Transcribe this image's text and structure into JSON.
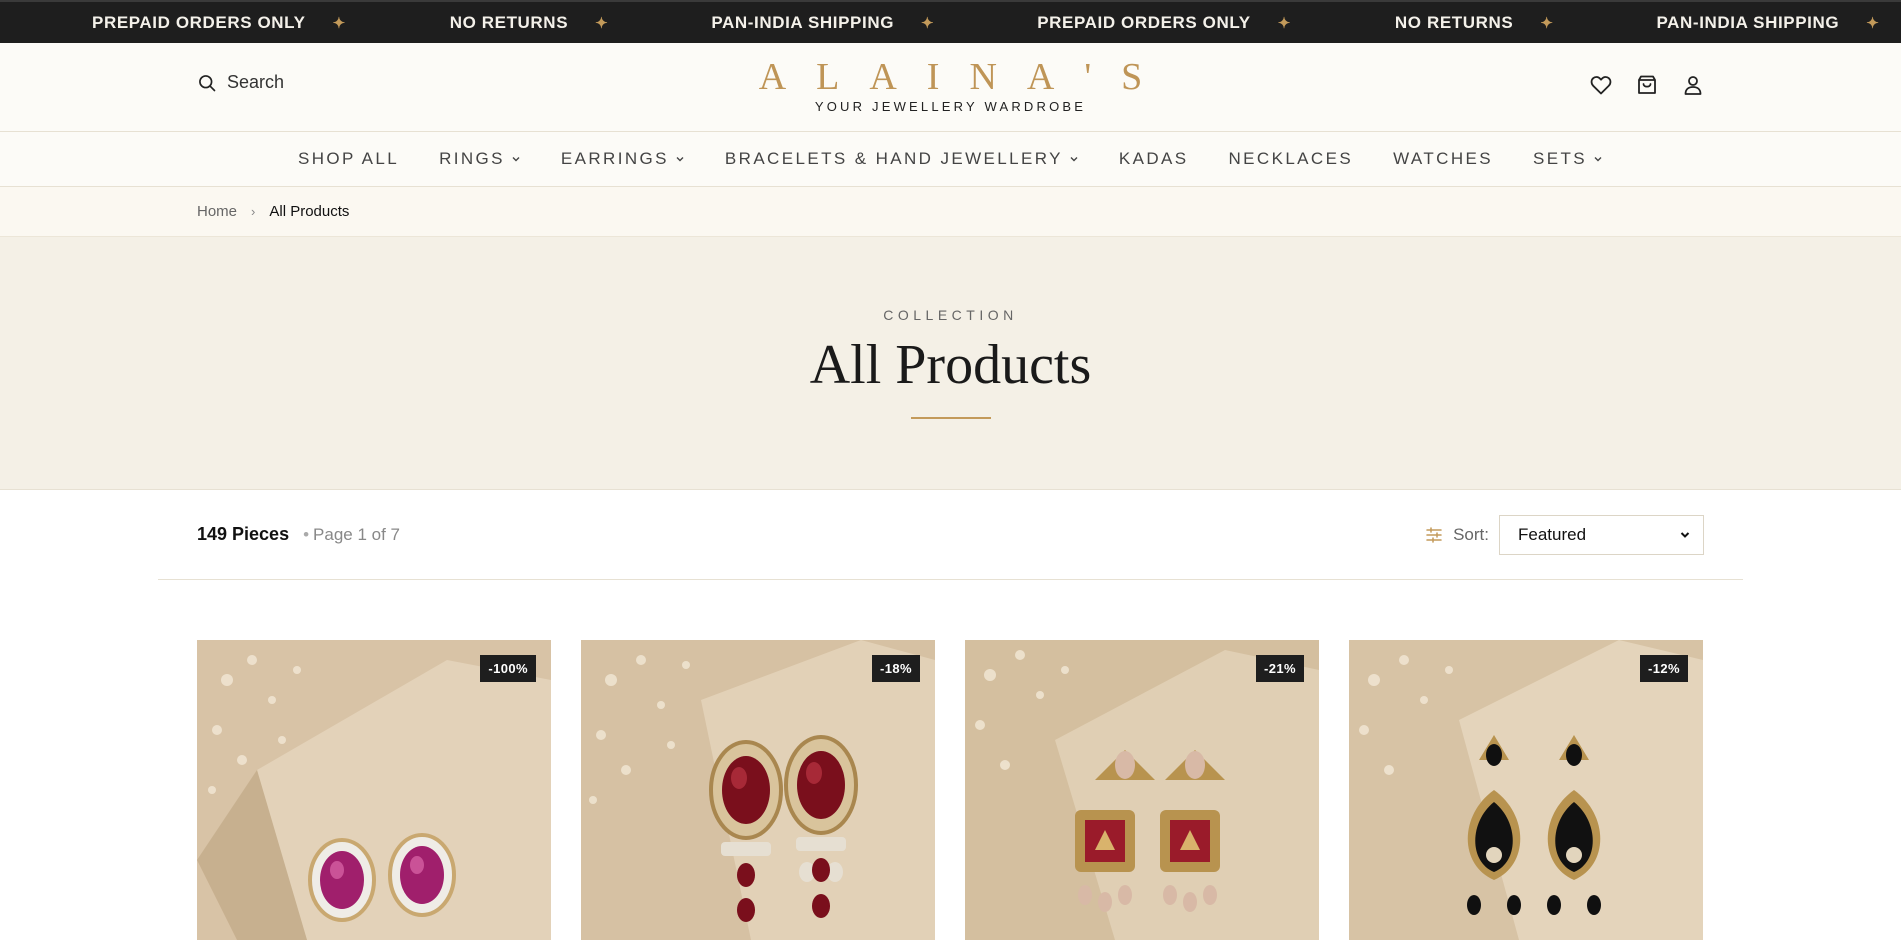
{
  "announcement": {
    "items": [
      "PREPAID ORDERS ONLY",
      "NO RETURNS",
      "PAN-INDIA SHIPPING",
      "PREPAID ORDERS ONLY",
      "NO RETURNS",
      "PAN-INDIA SHIPPING"
    ],
    "separator": "✦"
  },
  "header": {
    "search_label": "Search",
    "brand_name": "ALAINA'S",
    "brand_tagline": "YOUR JEWELLERY WARDROBE"
  },
  "nav": {
    "items": [
      {
        "label": "SHOP ALL"
      },
      {
        "label": "RINGS"
      },
      {
        "label": "EARRINGS"
      },
      {
        "label": "BRACELETS & HAND JEWELLERY"
      },
      {
        "label": "KADAS"
      },
      {
        "label": "NECKLACES"
      },
      {
        "label": "WATCHES"
      },
      {
        "label": "SETS"
      }
    ]
  },
  "breadcrumb": {
    "home": "Home",
    "separator": "›",
    "current": "All Products"
  },
  "hero": {
    "eyebrow": "COLLECTION",
    "title": "All Products"
  },
  "toolbar": {
    "count": "149 Pieces",
    "page_info": "Page 1 of 7",
    "page_dot": "•",
    "sort_label": "Sort:",
    "sort_value": "Featured"
  },
  "products": [
    {
      "badge": "-100%"
    },
    {
      "badge": "-18%"
    },
    {
      "badge": "-21%"
    },
    {
      "badge": "-12%"
    }
  ],
  "colors": {
    "accent_gold": "#c39a5a",
    "brand_gold": "#bf9557",
    "announcement_bg": "#1e1e1e",
    "hero_bg": "#f4f0e6",
    "badge_bg": "#1e1e1e"
  },
  "icons": [
    "search-icon",
    "wishlist-heart-icon",
    "cart-bag-icon",
    "account-user-icon",
    "chevron-down-icon",
    "filter-sliders-icon",
    "star-separator-icon"
  ]
}
